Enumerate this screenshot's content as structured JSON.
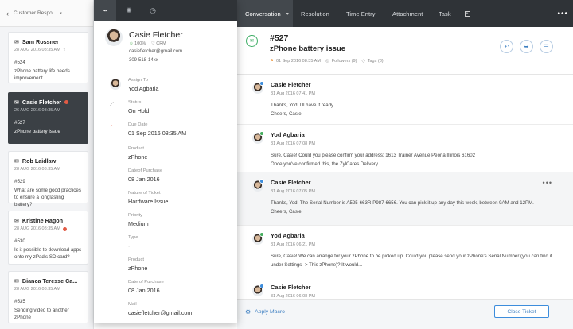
{
  "list": {
    "back_icon": "chevron-left",
    "title": "Customer Respo...",
    "title_caret": "▾",
    "tickets": [
      {
        "name": "Sam Rossner",
        "date": "28 AUG 2016 08:35 AM",
        "number": "#524",
        "subject": "zPhone battery life needs improvement",
        "selected": false,
        "overdue": false
      },
      {
        "name": "Casie Fletcher",
        "date": "26 AUG 2016 08:35 AM",
        "number": "#527",
        "subject": "zPhone battery issue",
        "selected": true,
        "overdue": true
      },
      {
        "name": "Rob Laidlaw",
        "date": "28 AUG 2016 08:35 AM",
        "number": "#529",
        "subject": "What are some good practices to ensure a longlasting battery?",
        "selected": false,
        "overdue": false
      },
      {
        "name": "Kristine Ragon",
        "date": "28 AUG 2016 08:35 AM",
        "number": "#530",
        "subject": "Is it possible to download apps onto my zPad's SD card?",
        "selected": false,
        "overdue": true
      },
      {
        "name": "Bianca Teresse Ca...",
        "date": "28 AUG 2016 08:35 AM",
        "number": "#535",
        "subject": "Sending video to another zPhone",
        "selected": false,
        "overdue": false
      }
    ]
  },
  "contact": {
    "tabs": [
      "contact-tab",
      "activity-tab",
      "history-tab"
    ],
    "name": "Casie Fletcher",
    "score": "100%",
    "crm": "CRM",
    "email": "casiefletcher@gmail.com",
    "phone": "309-518-14xx",
    "fields": [
      {
        "label": "Assign To",
        "value": "Yod Agbaria"
      },
      {
        "label": "Status",
        "value": "On Hold"
      },
      {
        "label": "Due Date",
        "value": "01 Sep 2016 08:35 AM"
      },
      {
        "label": "Product",
        "value": "zPhone"
      },
      {
        "label": "Dateof Purchase",
        "value": "08 Jan 2016"
      },
      {
        "label": "Nature of Ticket",
        "value": "Hardware Issue"
      },
      {
        "label": "Priority",
        "value": "Medium"
      },
      {
        "label": "Type",
        "value": "-"
      },
      {
        "label": "Product",
        "value": "zPhone"
      },
      {
        "label": "Date of Purchase",
        "value": "08 Jan 2016"
      },
      {
        "label": "Mail",
        "value": "casiefletcher@gmail.com"
      }
    ]
  },
  "nav": {
    "tabs": [
      "Conversation",
      "Resolution",
      "Time Entry",
      "Attachment",
      "Task"
    ],
    "active": "Conversation",
    "caret": "▾",
    "more": "•••"
  },
  "ticket": {
    "number": "#527",
    "subject": "zPhone battery issue",
    "date": "01 Sep 2016 08:35 AM",
    "followers": "Followers (9)",
    "tags": "Tags (8)"
  },
  "threads": [
    {
      "author": "Casie Fletcher",
      "time": "31 Aug 2016 07:41 PM",
      "lines": [
        "Thanks, Yod. I'll have it ready.",
        "Cheers, Casie"
      ],
      "type": "customer"
    },
    {
      "author": "Yod Agbaria",
      "time": "31 Aug 2016 07:08 PM",
      "lines": [
        "Sure, Casie! Could you please confirm your address: 1613 Trainer Avenue Peoria Illinois 61602",
        "Once you've confirmed this, the ZylCares Delivery..."
      ],
      "type": "agent"
    },
    {
      "author": "Casie Fletcher",
      "time": "31 Aug 2016 07:05 PM",
      "lines": [
        "Thanks, Yod! The Serial Number is A525-663R-P987-6656. You can pick it up any day this week, between 9AM and 12PM.",
        "Cheers, Casie"
      ],
      "type": "customer"
    },
    {
      "author": "Yod Agbaria",
      "time": "31 Aug 2016 06:21 PM",
      "lines": [
        "Sure, Casie! We can arrange for your zPhone to be picked up. Could you please send your zPhone's Serial Number (you can find it under Settings -> This zPhone)? It would..."
      ],
      "type": "agent"
    },
    {
      "author": "Casie Fletcher",
      "time": "31 Aug 2016 06:08 PM",
      "lines": [],
      "type": "customer"
    }
  ],
  "footer": {
    "macro": "Apply Macro",
    "close": "Close Ticket"
  },
  "colors": {
    "dark": "#2f3337",
    "accent": "#3d8ddc",
    "overdue": "#e25b45",
    "success": "#45ad5e"
  }
}
